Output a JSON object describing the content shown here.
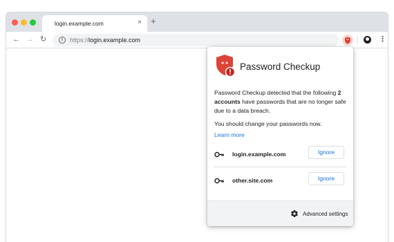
{
  "browser": {
    "tab_title": "login.example.com",
    "tab_close": "×",
    "new_tab": "+",
    "url_scheme": "https://",
    "url_host": "login.example.com",
    "icons": [
      "close-icon",
      "plus-icon",
      "back-icon",
      "forward-icon",
      "reload-icon",
      "info-icon",
      "password-checkup-extension-icon",
      "profile-icon",
      "menu-icon"
    ]
  },
  "popup": {
    "title": "Password Checkup",
    "desc_before": "Password Checkup detected that the following ",
    "desc_bold": "2 accounts",
    "desc_after": " have passwords that are no longer safe due to a data breach.",
    "advice": "You should change your passwords now.",
    "learn_more": "Learn more",
    "accounts": [
      {
        "site": "login.example.com",
        "action": "Ignore"
      },
      {
        "site": "other.site.com",
        "action": "Ignore"
      }
    ],
    "footer_label": "Advanced settings",
    "accent_color": "#1a73e8",
    "shield_color": "#db4437"
  }
}
